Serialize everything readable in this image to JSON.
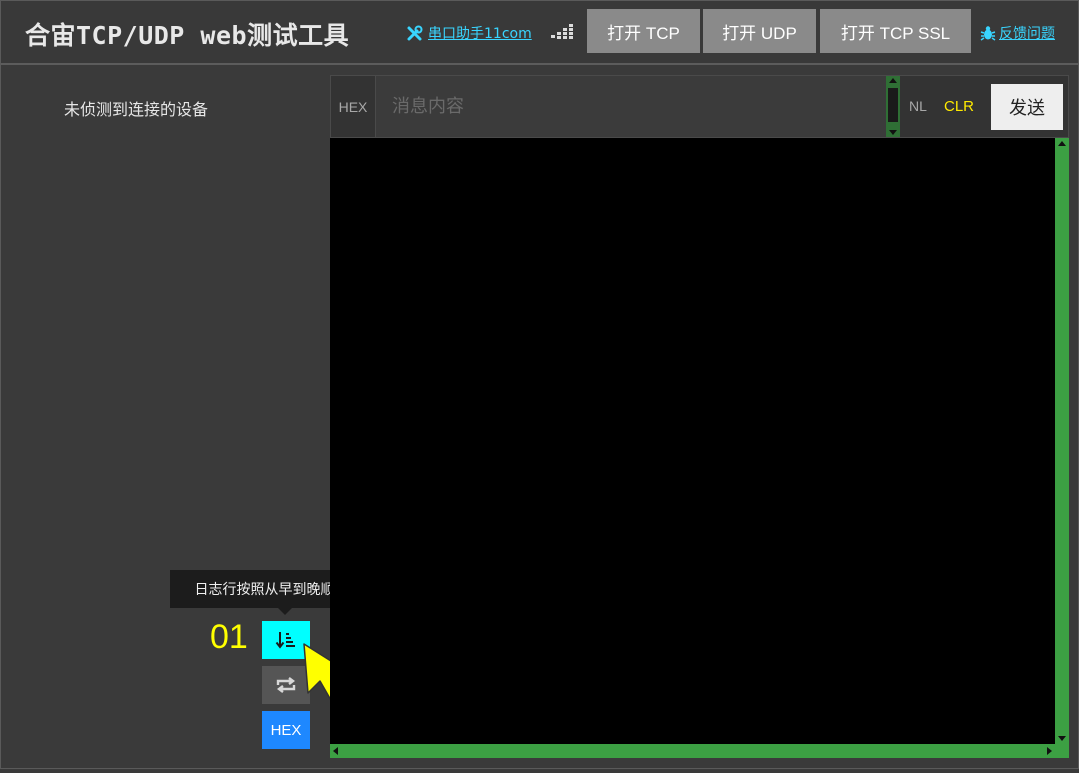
{
  "header": {
    "title": "合宙TCP/UDP web测试工具",
    "tools_link": "串口助手11com",
    "buttons": {
      "tcp": "打开 TCP",
      "udp": "打开 UDP",
      "ssl": "打开 TCP SSL"
    },
    "feedback_link": "反馈问题",
    "icons": [
      "tools-icon",
      "equalizer-icon",
      "bug-icon"
    ]
  },
  "left_panel": {
    "status": "未侦测到连接的设备",
    "tooltip": "日志行按照从早到晚顺序排列",
    "step_number": "01",
    "buttons": {
      "sort_icon": "sort-ascending-icon",
      "loop_icon": "repeat-icon",
      "hex": "HEX"
    }
  },
  "input_row": {
    "hex_toggle": "HEX",
    "message_placeholder": "消息内容",
    "message_value": "",
    "nl_toggle": "NL",
    "clear": "CLR",
    "send": "发送"
  },
  "colors": {
    "accent_cyan": "#00ffff",
    "link": "#39d5ff",
    "clear": "#ffea00",
    "scrollbar": "#3ca043",
    "hex_button": "#1e88ff",
    "step_number": "#ffff00"
  }
}
